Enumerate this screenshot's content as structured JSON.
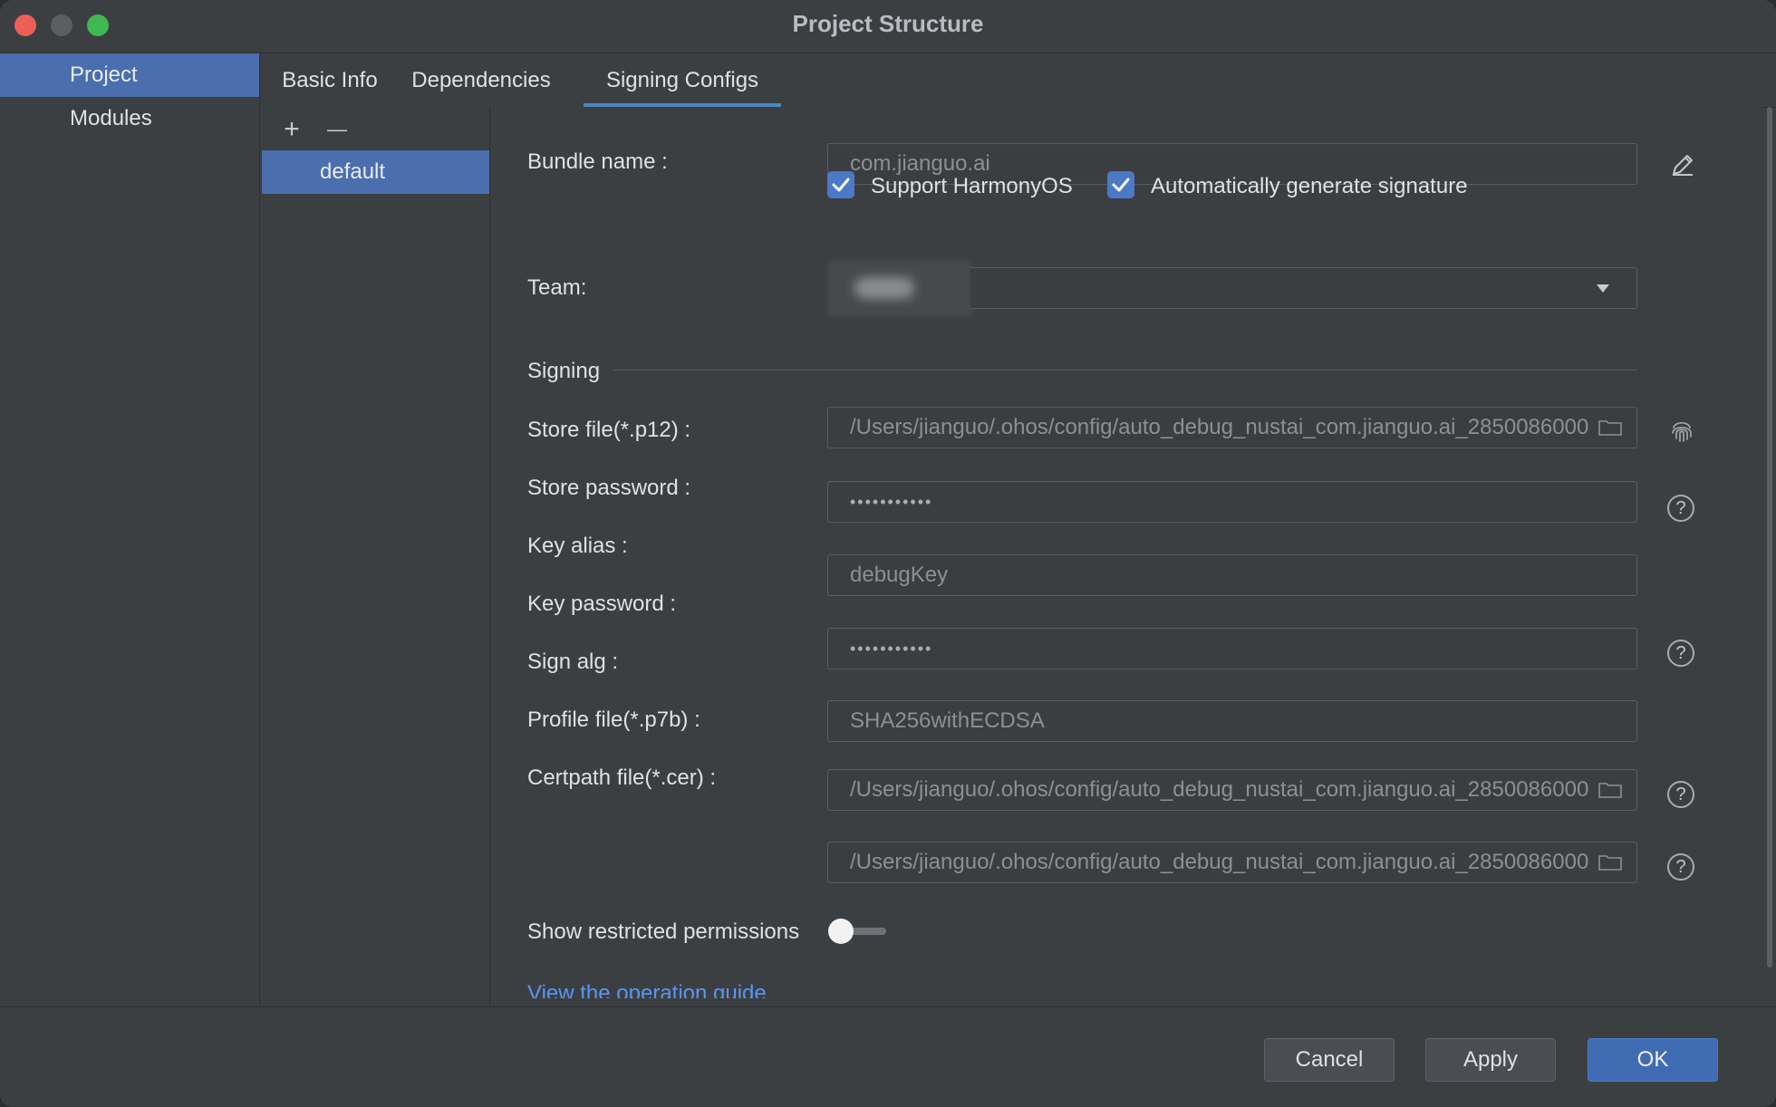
{
  "window": {
    "title": "Project Structure"
  },
  "sidebar": {
    "items": [
      {
        "label": "Project",
        "selected": true
      },
      {
        "label": "Modules",
        "selected": false
      }
    ]
  },
  "tabs": [
    {
      "label": "Basic Info"
    },
    {
      "label": "Dependencies"
    },
    {
      "label": "Signing Configs",
      "active": true
    }
  ],
  "list": {
    "add": "+",
    "remove": "—",
    "items": [
      "default"
    ]
  },
  "form": {
    "bundle_name_label": "Bundle name :",
    "bundle_name_value": "com.jianguo.ai",
    "support_harmonyos": {
      "label": "Support HarmonyOS",
      "checked": true
    },
    "auto_sign": {
      "label": "Automatically generate signature",
      "checked": true
    },
    "team_label": "Team:",
    "signing_section": "Signing",
    "store_file_label": "Store file(*.p12) :",
    "store_file_value": "/Users/jianguo/.ohos/config/auto_debug_nustai_com.jianguo.ai_2850086000",
    "store_password_label": "Store password :",
    "store_password_value": "•••••••••••",
    "key_alias_label": "Key alias :",
    "key_alias_value": "debugKey",
    "key_password_label": "Key password :",
    "key_password_value": "•••••••••••",
    "sign_alg_label": "Sign alg :",
    "sign_alg_value": "SHA256withECDSA",
    "profile_file_label": "Profile file(*.p7b) :",
    "profile_file_value": "/Users/jianguo/.ohos/config/auto_debug_nustai_com.jianguo.ai_2850086000",
    "certpath_file_label": "Certpath file(*.cer) :",
    "certpath_file_value": "/Users/jianguo/.ohos/config/auto_debug_nustai_com.jianguo.ai_2850086000",
    "restricted_label": "Show restricted permissions",
    "restricted_on": false,
    "guide_link": "View the operation guide",
    "help_glyph": "?"
  },
  "footer": {
    "cancel": "Cancel",
    "apply": "Apply",
    "ok": "OK"
  },
  "colors": {
    "accent": "#4b6eaf",
    "checkbox": "#4c79c7",
    "link": "#5896f5",
    "primary_button": "#3f6cb3"
  }
}
